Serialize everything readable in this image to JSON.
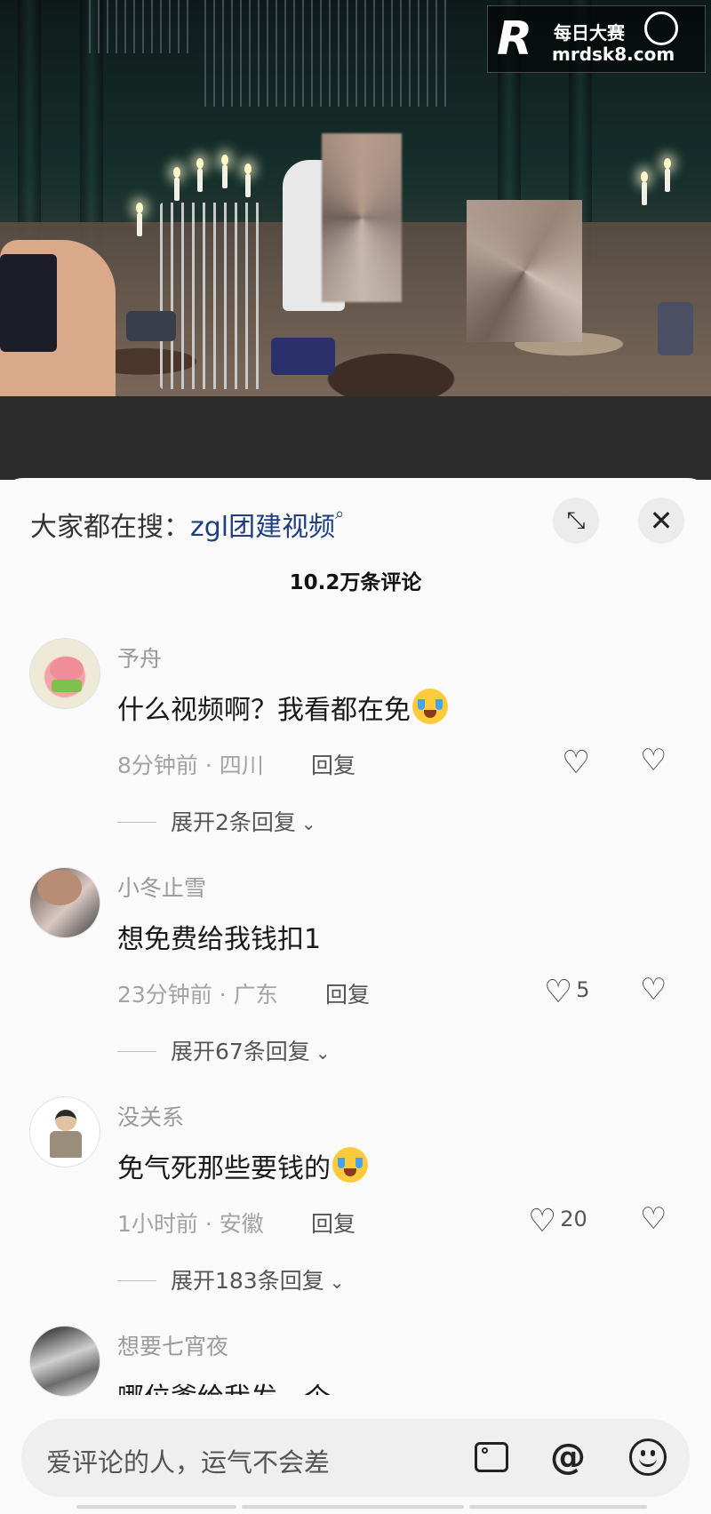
{
  "watermark": {
    "logo_letter": "R",
    "name": "每日大赛",
    "url": "mrdsk8.com"
  },
  "sheet": {
    "search_prefix": "大家都在搜：",
    "search_term": "zgl团建视频",
    "expand_icon": "expand-icon",
    "close_icon": "close-icon",
    "comment_count": "10.2万条评论"
  },
  "comments": [
    {
      "user": "予舟",
      "text": "什么视频啊？我看都在免",
      "emoji": "crying-laughing",
      "meta": "8分钟前 · 四川",
      "reply_label": "回复",
      "likes": "",
      "expand_label": "展开2条回复"
    },
    {
      "user": "小冬止雪",
      "text": "想免费给我钱扣1",
      "emoji": "",
      "meta": "23分钟前 · 广东",
      "reply_label": "回复",
      "likes": "5",
      "expand_label": "展开67条回复"
    },
    {
      "user": "没关系",
      "text": "免气死那些要钱的",
      "emoji": "crying-laughing",
      "meta": "1小时前 · 安徽",
      "reply_label": "回复",
      "likes": "20",
      "expand_label": "展开183条回复"
    },
    {
      "user": "想要七宵夜",
      "text": "哪位爹给我发一个",
      "emoji": "",
      "meta": "",
      "reply_label": "",
      "likes": "",
      "expand_label": ""
    }
  ],
  "input_bar": {
    "placeholder": "爱评论的人，运气不会差",
    "icons": [
      "image-icon",
      "at-icon",
      "emoji-icon"
    ]
  },
  "colors": {
    "sheet_bg": "#fafafa",
    "search_link": "#1f3f7f",
    "muted_text": "#9a9a9a",
    "input_bg": "#efefef"
  }
}
